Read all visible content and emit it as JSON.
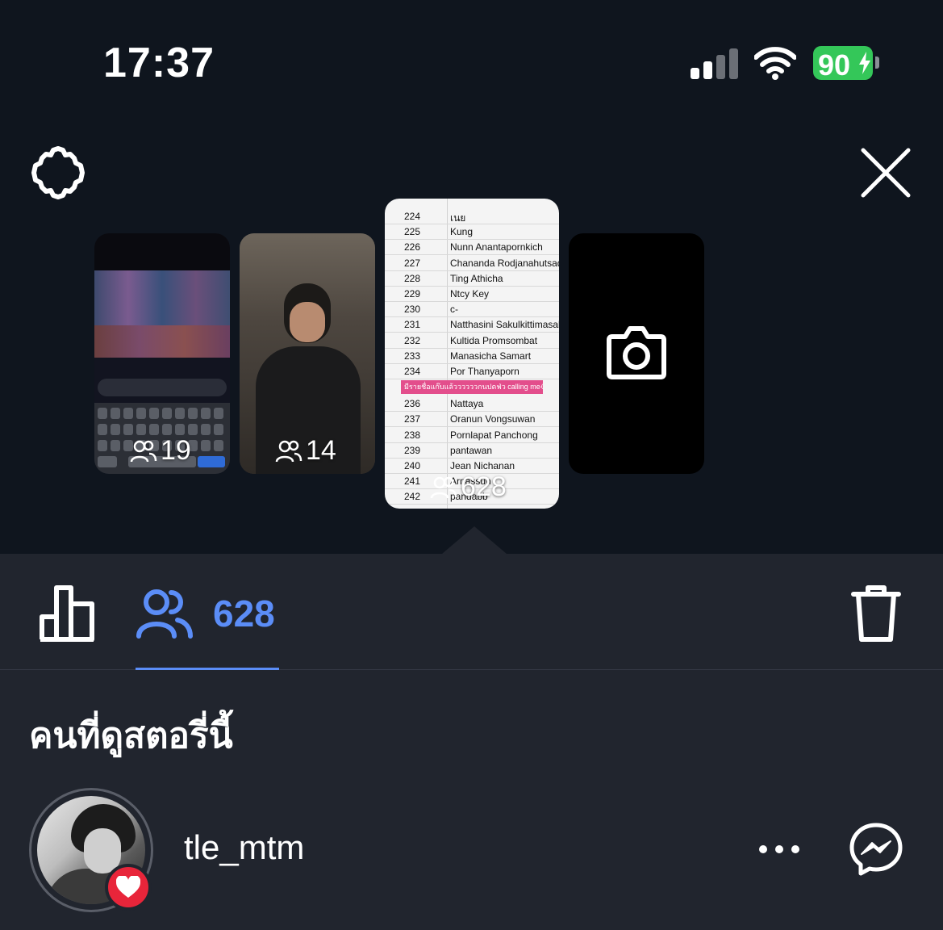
{
  "status_bar": {
    "time": "17:37",
    "battery_level": "90"
  },
  "stories": [
    {
      "viewers": "19"
    },
    {
      "viewers": "14"
    },
    {
      "viewers": "628"
    },
    {
      "viewers": ""
    }
  ],
  "spreadsheet": {
    "rows": [
      {
        "n": "224",
        "v": "เนย"
      },
      {
        "n": "225",
        "v": "Kung"
      },
      {
        "n": "226",
        "v": "Nunn Anantapornkich"
      },
      {
        "n": "227",
        "v": "Chananda Rodjanahutsad"
      },
      {
        "n": "228",
        "v": "Ting Athicha"
      },
      {
        "n": "229",
        "v": "Ntcy Key"
      },
      {
        "n": "230",
        "v": "c-"
      },
      {
        "n": "231",
        "v": "Natthasini Sakulkittimasak"
      },
      {
        "n": "232",
        "v": "Kultida Promsombat"
      },
      {
        "n": "233",
        "v": "Manasicha Samart"
      },
      {
        "n": "234",
        "v": "Por Thanyaporn"
      },
      {
        "n": "236",
        "v": "Nattaya"
      },
      {
        "n": "237",
        "v": "Oranun Vongsuwan"
      },
      {
        "n": "238",
        "v": "Pornlapat Panchong"
      },
      {
        "n": "239",
        "v": "pantawan"
      },
      {
        "n": "240",
        "v": "Jean Nichanan"
      },
      {
        "n": "241",
        "v": "Arnassun"
      },
      {
        "n": "242",
        "v": "pandabb"
      }
    ],
    "banner": "มีรายชื่อแก๊บแล้ววววววกนปดฟ่ว calling me😭"
  },
  "toolbar": {
    "viewers_count": "628"
  },
  "section": {
    "title": "คนที่ดูสตอรี่นี้"
  },
  "viewer": {
    "username": "tle_mtm"
  },
  "colors": {
    "accent": "#5b8df7",
    "battery": "#34c759",
    "heart": "#e8253a",
    "sheet": "#21252e",
    "background": "#0f151e"
  }
}
